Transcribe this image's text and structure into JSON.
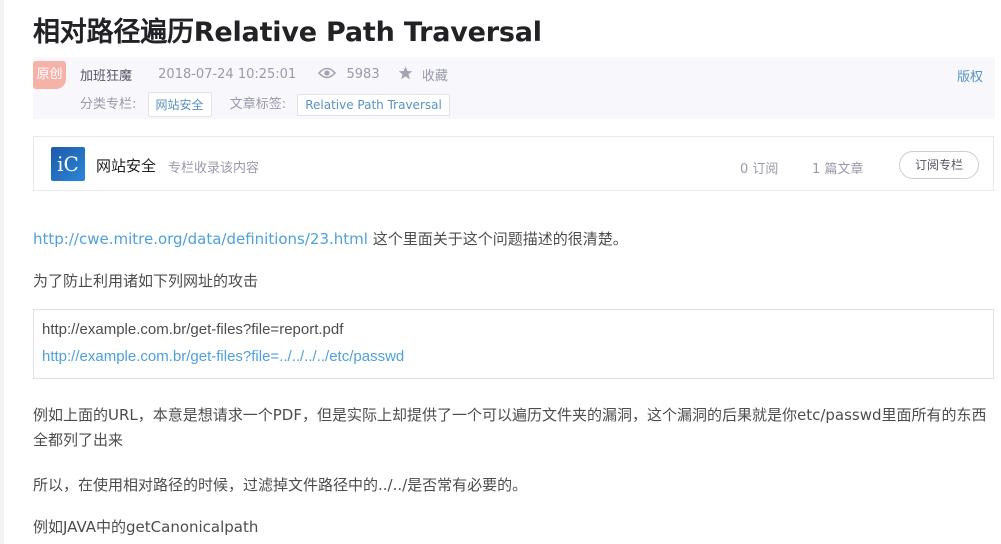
{
  "article": {
    "title": "相对路径遍历Relative Path Traversal",
    "original_tag": "原创",
    "author": "加班狂魔",
    "date": "2018-07-24 10:25:01",
    "views": "5983",
    "favorite_label": "收藏",
    "copyright_label": "版权",
    "category_label": "分类专栏:",
    "category": "网站安全",
    "tags_label": "文章标签:",
    "tag": "Relative Path Traversal"
  },
  "column": {
    "logo_text": "iC",
    "name": "网站安全",
    "description": "专栏收录该内容",
    "subscribers": "0 订阅",
    "articles": "1 篇文章",
    "subscribe_button": "订阅专栏"
  },
  "content": {
    "p1_link": "http://cwe.mitre.org/data/definitions/23.html",
    "p1_text": " 这个里面关于这个问题描述的很清楚。",
    "p2": "为了防止利用诸如下列网址的攻击",
    "code_line1": "http://example.com.br/get-files?file=report.pdf",
    "code_line2": "http://example.com.br/get-files?file=../../../../etc/passwd",
    "p3": "例如上面的URL，本意是想请求一个PDF，但是实际上却提供了一个可以遍历文件夹的漏洞，这个漏洞的后果就是你etc/passwd里面所有的东西全都列了出来",
    "p4": "所以，在使用相对路径的时候，过滤掉文件路径中的../../是否常有必要的。",
    "p5": "例如JAVA中的getCanonicalpath"
  },
  "colors": {
    "link": "#4ea1db",
    "original_tag": "#f5b2a8",
    "meta_background": "#f7f7fc"
  },
  "icons": [
    "eye-icon",
    "star-icon"
  ]
}
